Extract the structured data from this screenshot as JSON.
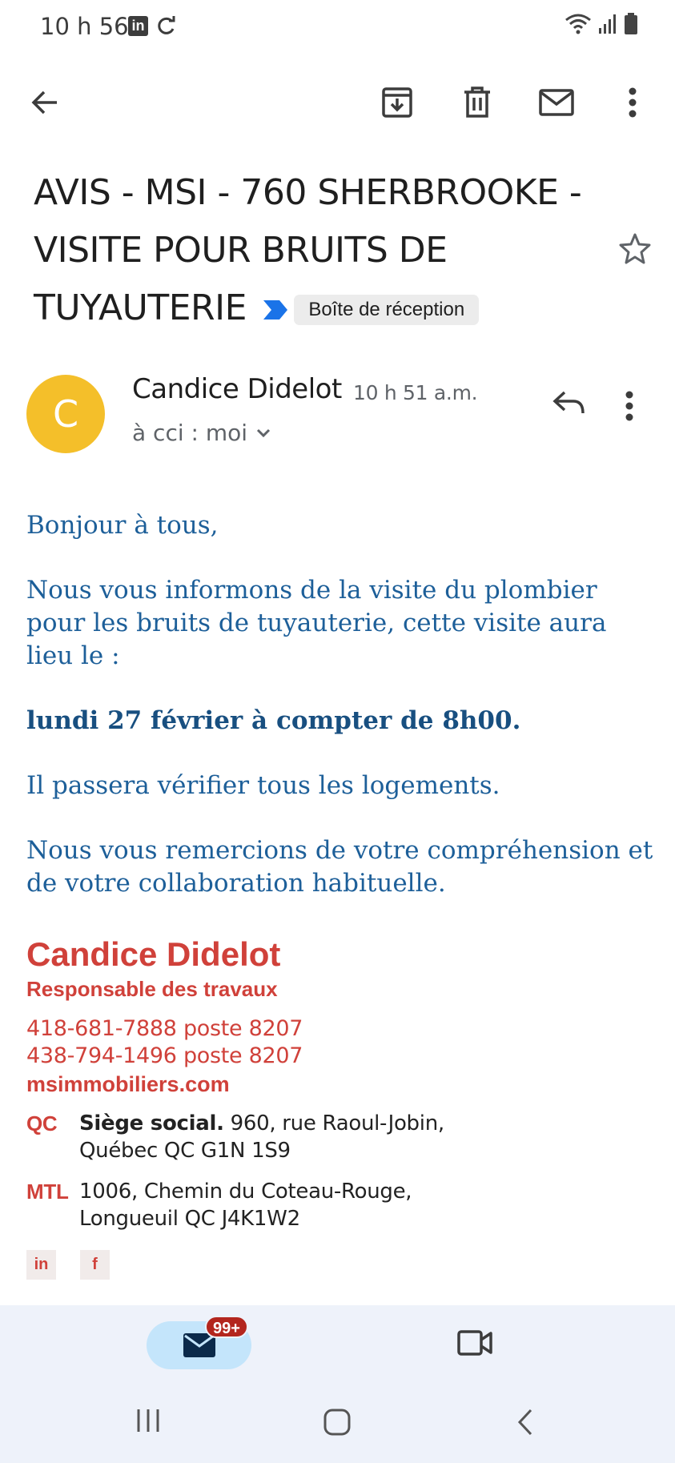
{
  "status_bar": {
    "time": "10 h 56",
    "icons": [
      "linkedin-icon",
      "sync-icon",
      "wifi-icon",
      "signal-icon",
      "battery-icon"
    ]
  },
  "toolbar": {
    "icons": [
      "back-arrow-icon",
      "archive-icon",
      "delete-icon",
      "mark-unread-icon",
      "more-vert-icon"
    ]
  },
  "email": {
    "subject": "AVIS - MSI - 760 SHERBROOKE - VISITE POUR BRUITS DE TUYAUTERIE",
    "label": "Boîte de réception",
    "sender": {
      "initial": "C",
      "name": "Candice Didelot",
      "time": "10 h 51 a.m.",
      "recipients": "à cci : moi"
    },
    "body": {
      "greeting": "Bonjour à tous,",
      "para1": "Nous vous informons de la visite du plombier pour les bruits de tuyauterie, cette visite aura lieu le :",
      "date": "lundi 27 février à compter de 8h00.",
      "para2": "Il passera vérifier tous les logements.",
      "para3": "Nous vous remercions de votre compréhension et de votre collaboration habituelle."
    },
    "signature": {
      "name": "Candice Didelot",
      "title": "Responsable des travaux",
      "phone1": "418-681-7888 poste 8207",
      "phone2": "438-794-1496 poste 8207",
      "website": "msimmobiliers.com",
      "addresses": [
        {
          "code": "QC",
          "bold": "Siège social.",
          "line1": " 960, rue Raoul-Jobin,",
          "line2": "Québec QC G1N 1S9"
        },
        {
          "code": "MTL",
          "bold": "",
          "line1": "1006, Chemin du Coteau-Rouge,",
          "line2": "Longueuil QC J4K1W2"
        }
      ],
      "social": [
        "in",
        "f"
      ]
    }
  },
  "bottom_nav": {
    "mail_badge": "99+",
    "items": [
      "mail-icon",
      "video-icon"
    ]
  },
  "colors": {
    "avatar": "#f4bf2a",
    "body_text": "#1d5f99",
    "signature": "#d0413a",
    "nav_bg": "#eef2fa",
    "pill": "#c4e5fb",
    "badge": "#b3261e"
  }
}
